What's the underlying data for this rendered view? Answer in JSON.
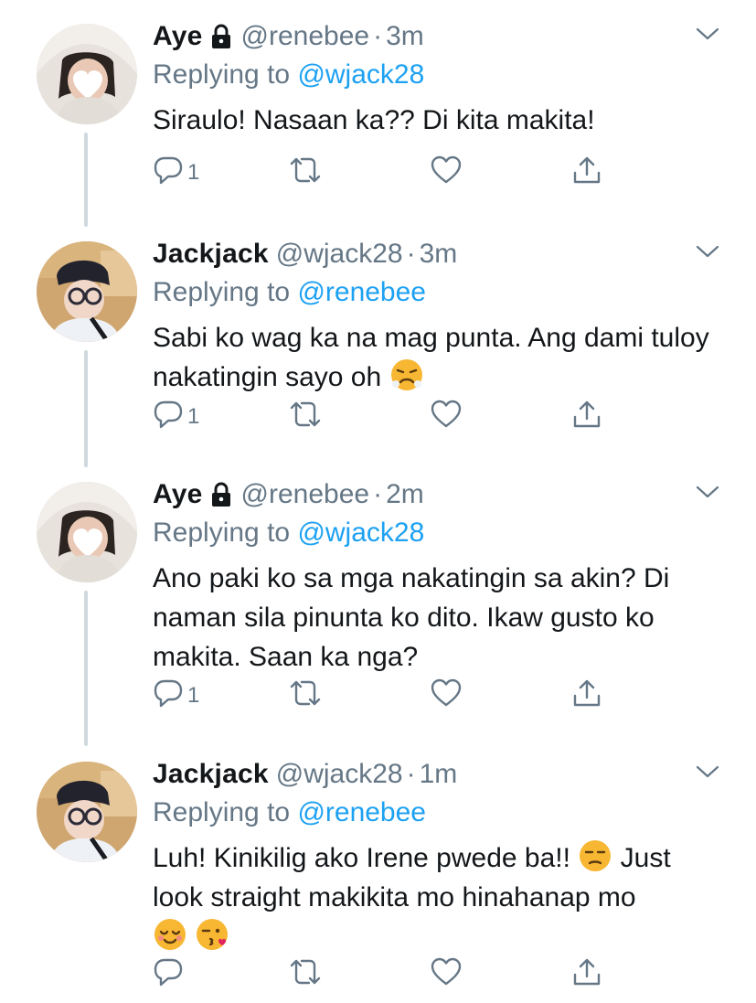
{
  "tweets": [
    {
      "name": "Aye",
      "handle": "@renebee",
      "dot": "·",
      "time": "3m",
      "replying_prefix": "Replying to ",
      "replying_to": "@wjack28",
      "text": "Siraulo! Nasaan ka?? Di kita makita!",
      "reply_count": "1",
      "locked": true,
      "avatar": "user-aye-avatar"
    },
    {
      "name": "Jackjack",
      "handle": "@wjack28",
      "dot": "·",
      "time": "3m",
      "replying_prefix": "Replying to ",
      "replying_to": "@renebee",
      "text": "Sabi ko wag ka na mag punta. Ang dami tuloy nakatingin sayo oh",
      "emojis": [
        "😤"
      ],
      "reply_count": "1",
      "locked": false,
      "avatar": "user-jackjack-avatar"
    },
    {
      "name": "Aye",
      "handle": "@renebee",
      "dot": "·",
      "time": "2m",
      "replying_prefix": "Replying to ",
      "replying_to": "@wjack28",
      "text": "Ano paki ko sa mga nakatingin sa akin? Di naman sila pinunta ko dito. Ikaw gusto ko makita. Saan ka nga?",
      "reply_count": "1",
      "locked": true,
      "avatar": "user-aye-avatar"
    },
    {
      "name": "Jackjack",
      "handle": "@wjack28",
      "dot": "·",
      "time": "1m",
      "replying_prefix": "Replying to ",
      "replying_to": "@renebee",
      "text_part1": "Luh! Kinikilig ako Irene pwede ba!! ",
      "text_part2": " Just look straight makikita mo hinahanap mo",
      "emojis": [
        "😒",
        "😌",
        "😘"
      ],
      "reply_count": "",
      "locked": false,
      "avatar": "user-jackjack-avatar"
    }
  ],
  "icons": {
    "reply": "reply-icon",
    "retweet": "retweet-icon",
    "like": "heart-icon",
    "share": "share-icon",
    "caret": "chevron-down-icon",
    "lock": "lock-icon"
  },
  "colors": {
    "text": "#14171a",
    "secondary": "#657786",
    "link": "#1da1f2",
    "thread_line": "#cfd9de"
  }
}
